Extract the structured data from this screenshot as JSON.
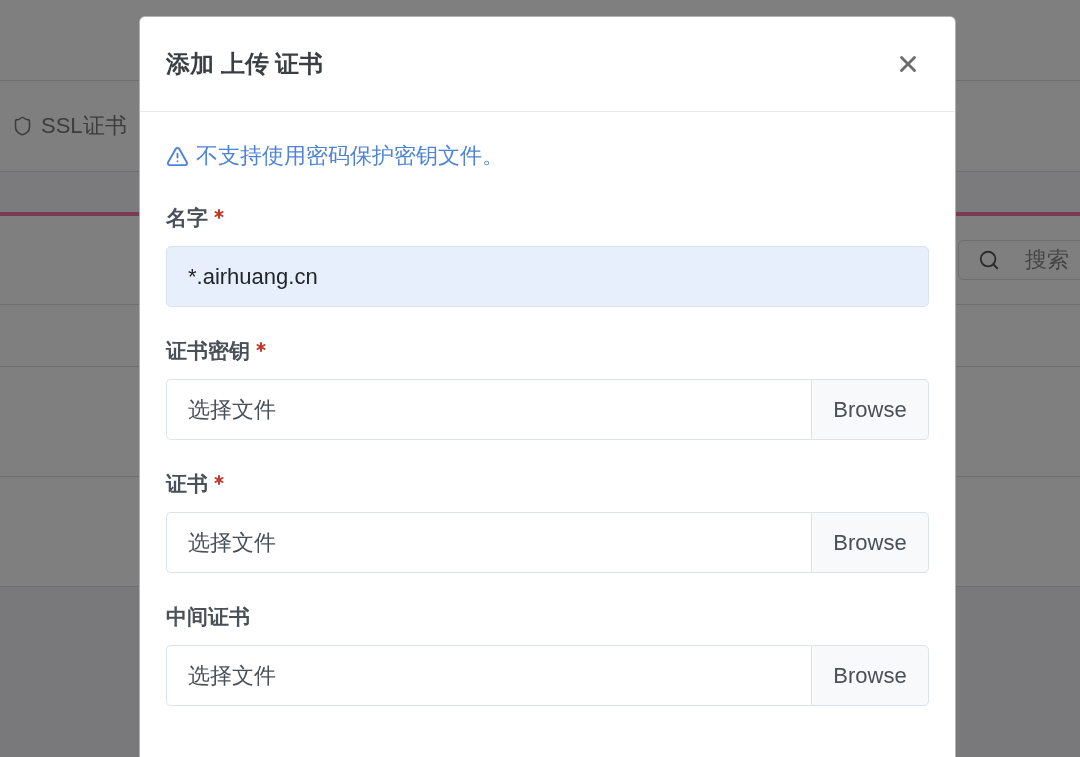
{
  "page": {
    "tab": {
      "label": "SSL证书"
    },
    "search": {
      "placeholder": "搜索"
    }
  },
  "dialog": {
    "title": "添加 上传 证书",
    "notice": "不支持使用密码保护密钥文件。",
    "fields": [
      {
        "kind": "text",
        "label": "名字",
        "required": true,
        "value": "*.airhuang.cn",
        "autofilled": true
      },
      {
        "kind": "file",
        "label": "证书密钥",
        "required": true,
        "placeholder": "选择文件",
        "button": "Browse"
      },
      {
        "kind": "file",
        "label": "证书",
        "required": true,
        "placeholder": "选择文件",
        "button": "Browse"
      },
      {
        "kind": "file",
        "label": "中间证书",
        "required": false,
        "placeholder": "选择文件",
        "button": "Browse"
      }
    ]
  }
}
